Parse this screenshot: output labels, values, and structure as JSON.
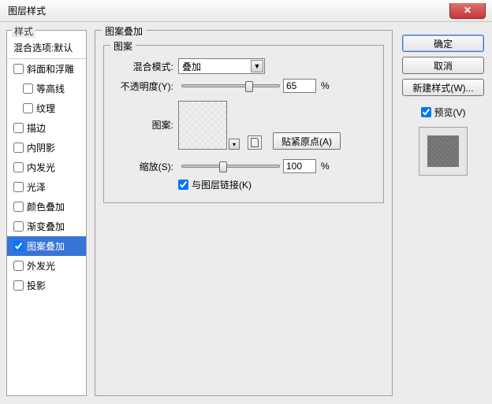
{
  "window": {
    "title": "图层样式",
    "close_glyph": "✕"
  },
  "left": {
    "group": "样式",
    "blend_defaults": "混合选项:默认",
    "items": [
      {
        "label": "斜面和浮雕",
        "checked": false,
        "sub": false
      },
      {
        "label": "等高线",
        "checked": false,
        "sub": true
      },
      {
        "label": "纹理",
        "checked": false,
        "sub": true
      },
      {
        "label": "描边",
        "checked": false,
        "sub": false
      },
      {
        "label": "内阴影",
        "checked": false,
        "sub": false
      },
      {
        "label": "内发光",
        "checked": false,
        "sub": false
      },
      {
        "label": "光泽",
        "checked": false,
        "sub": false
      },
      {
        "label": "颜色叠加",
        "checked": false,
        "sub": false
      },
      {
        "label": "渐变叠加",
        "checked": false,
        "sub": false
      },
      {
        "label": "图案叠加",
        "checked": true,
        "sub": false,
        "selected": true
      },
      {
        "label": "外发光",
        "checked": false,
        "sub": false
      },
      {
        "label": "投影",
        "checked": false,
        "sub": false
      }
    ]
  },
  "mid": {
    "outer_legend": "图案叠加",
    "inner_legend": "图案",
    "blend_mode_label": "混合模式:",
    "blend_mode_value": "叠加",
    "opacity_label": "不透明度(Y):",
    "opacity_value": "65",
    "opacity_unit": "%",
    "pattern_label": "图案:",
    "snap_btn": "贴紧原点(A)",
    "scale_label": "缩放(S):",
    "scale_value": "100",
    "scale_unit": "%",
    "link_label": "与图层链接(K)",
    "link_checked": true
  },
  "right": {
    "ok": "确定",
    "cancel": "取消",
    "new_style": "新建样式(W)...",
    "preview_label": "预览(V)",
    "preview_checked": true
  },
  "colors": {
    "selection": "#3874d6"
  }
}
